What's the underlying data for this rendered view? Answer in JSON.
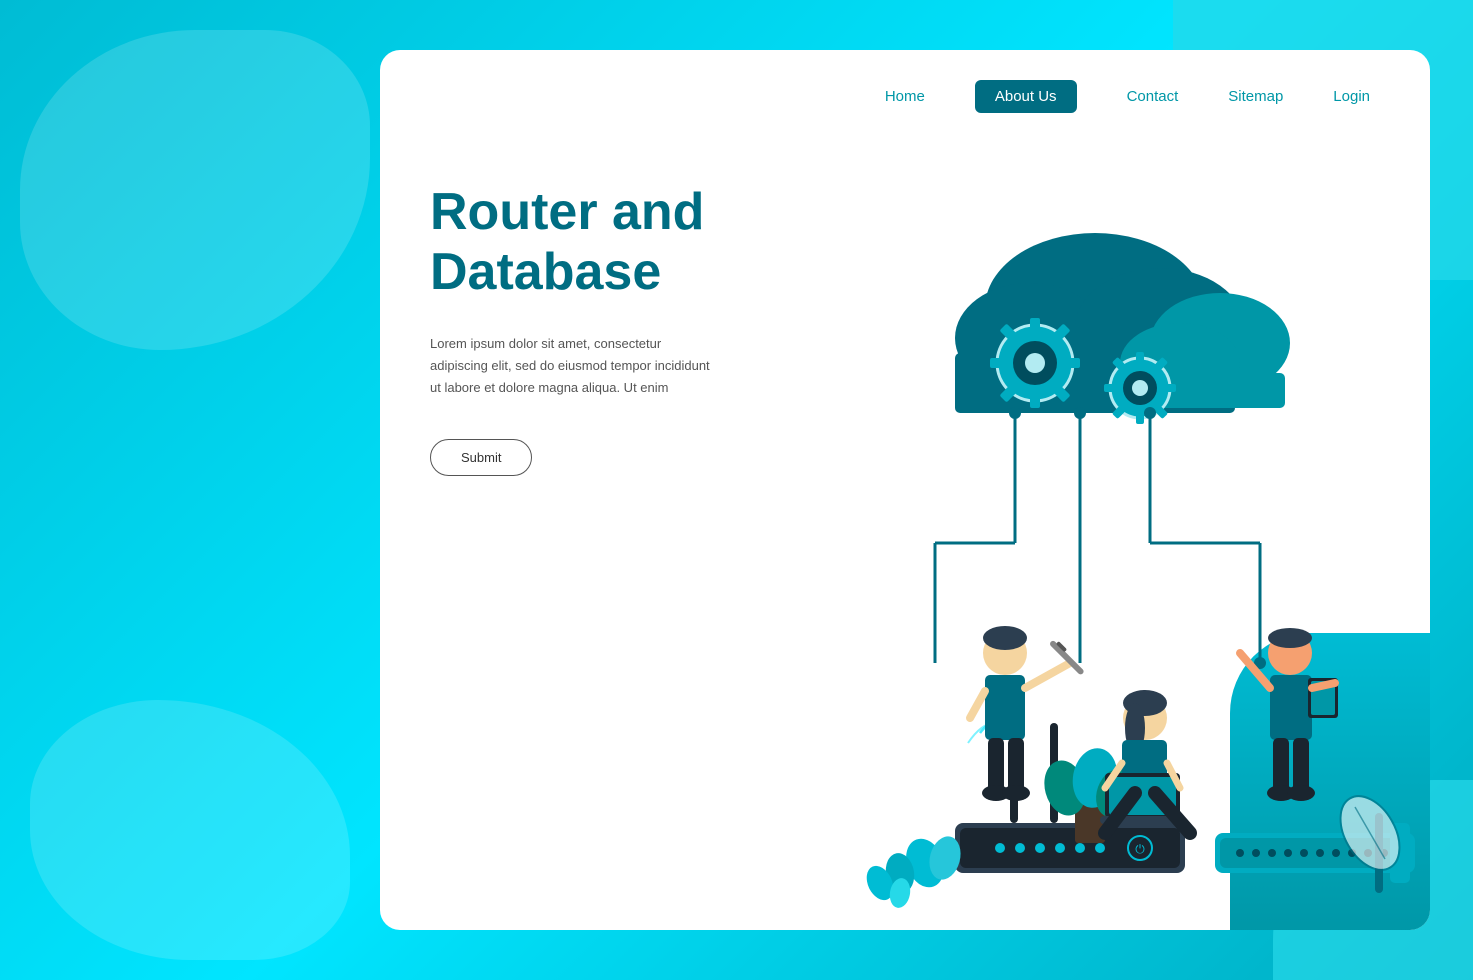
{
  "background": {
    "color": "#00c8d4"
  },
  "nav": {
    "items": [
      {
        "label": "Home",
        "active": false
      },
      {
        "label": "About Us",
        "active": true
      },
      {
        "label": "Contact",
        "active": false
      },
      {
        "label": "Sitemap",
        "active": false
      },
      {
        "label": "Login",
        "active": false
      }
    ]
  },
  "hero": {
    "title_line1": "Router and",
    "title_line2": "Database",
    "description": "Lorem ipsum dolor sit amet, consectetur adipiscing elit, sed do eiusmod tempor incididunt ut labore et dolore magna aliqua. Ut enim",
    "submit_label": "Submit"
  }
}
